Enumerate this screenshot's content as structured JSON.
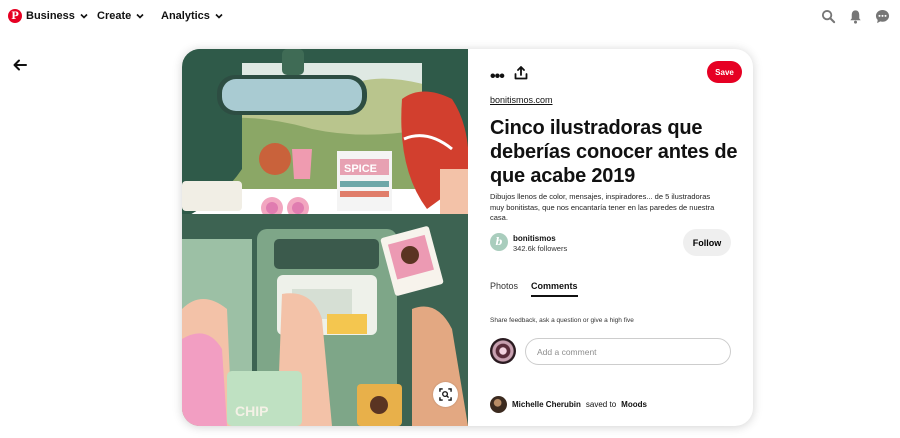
{
  "topbar": {
    "logo_letter": "P",
    "business_label": "Business",
    "create_label": "Create",
    "analytics_label": "Analytics",
    "icons": [
      "search-icon",
      "notifications-bell-icon",
      "messages-icon"
    ]
  },
  "pin": {
    "image_text": {
      "spice_label": "SPICE",
      "chips_label": "CHIP"
    },
    "source": "bonitismos.com",
    "title": "Cinco ilustradoras que deberías conocer antes de que acabe 2019",
    "description": "Dibujos llenos de color, mensajes, inspiradores... de 5 ilustradoras muy bonitistas, que nos encantaría tener en las paredes de nuestra casa.",
    "save_label": "Save",
    "more_icon": "more-icon",
    "share_icon": "share-icon",
    "lens_icon": "visual-search-icon"
  },
  "profile": {
    "avatar_letter": "b",
    "name": "bonitismos",
    "followers": "342.6k followers",
    "follow_label": "Follow"
  },
  "tabs": [
    "Photos",
    "Comments"
  ],
  "active_tab": "Comments",
  "comments": {
    "hint": "Share feedback, ask a question or give a high five",
    "placeholder": "Add a comment"
  },
  "saved_by": {
    "user": "Michelle Cherubin",
    "text": "saved to",
    "board": "Moods"
  },
  "colors": {
    "brand_red": "#e60023",
    "avatar_green": "#a9cdbd"
  }
}
